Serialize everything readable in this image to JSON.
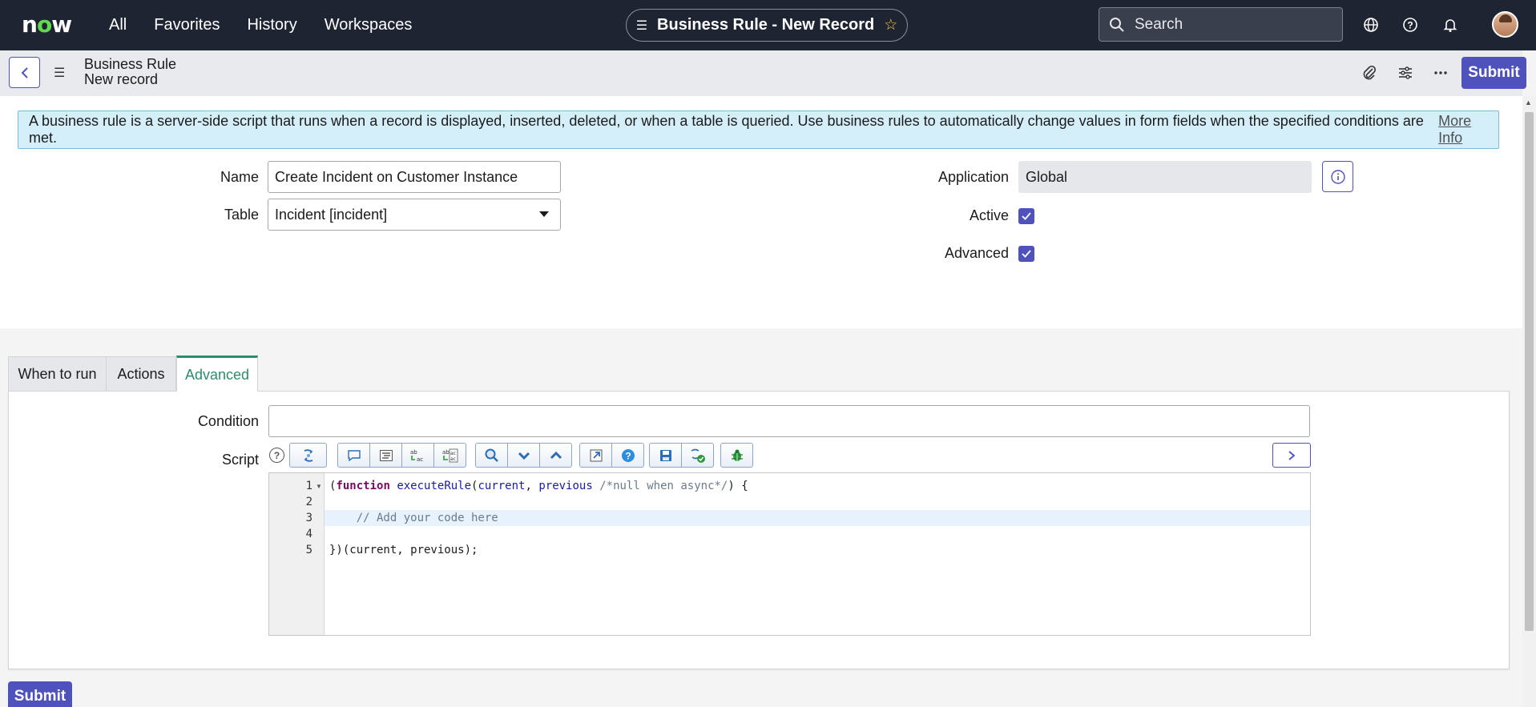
{
  "topnav": {
    "logo": "now",
    "links": [
      "All",
      "Favorites",
      "History",
      "Workspaces"
    ],
    "center_title": "Business Rule - New Record",
    "search_placeholder": "Search"
  },
  "header": {
    "title_line1": "Business Rule",
    "title_line2": "New record",
    "submit_label": "Submit"
  },
  "info": {
    "text": "A business rule is a server-side script that runs when a record is displayed, inserted, deleted, or when a table is queried. Use business rules to automatically change values in form fields when the specified conditions are met.",
    "link": "More Info"
  },
  "form": {
    "name_label": "Name",
    "name_value": "Create Incident on Customer Instance",
    "table_label": "Table",
    "table_value": "Incident [incident]",
    "application_label": "Application",
    "application_value": "Global",
    "active_label": "Active",
    "active_checked": true,
    "advanced_label": "Advanced",
    "advanced_checked": true
  },
  "tabs": [
    {
      "label": "When to run",
      "active": false
    },
    {
      "label": "Actions",
      "active": false
    },
    {
      "label": "Advanced",
      "active": true
    }
  ],
  "advanced": {
    "condition_label": "Condition",
    "condition_value": "",
    "script_label": "Script",
    "help_icon": "?",
    "code_lines": [
      {
        "num": "1",
        "text": "(function executeRule(current, previous /*null when async*/) {"
      },
      {
        "num": "2",
        "text": ""
      },
      {
        "num": "3",
        "text": "    // Add your code here"
      },
      {
        "num": "4",
        "text": ""
      },
      {
        "num": "5",
        "text": "})(current, previous);"
      }
    ]
  },
  "footer": {
    "submit_label": "Submit"
  },
  "colors": {
    "nav_bg": "#1f2433",
    "accent": "#4f52bd",
    "tab_active": "#2e8b6e",
    "info_bg": "#d4eefa"
  },
  "icons": [
    "search-icon",
    "globe-icon",
    "help-icon",
    "bell-icon",
    "avatar",
    "back-icon",
    "menu-icon",
    "attachment-icon",
    "settings-sliders-icon",
    "more-icon",
    "info-icon",
    "check-icon",
    "chevron-right-icon"
  ]
}
